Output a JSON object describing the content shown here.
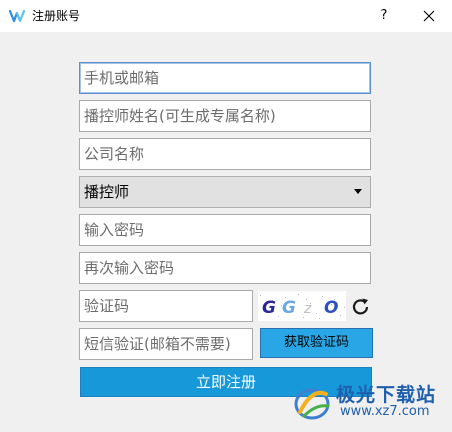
{
  "window": {
    "title": "注册账号",
    "help_label": "?",
    "app_icon": "app-logo-icon",
    "close_icon": "close-icon"
  },
  "form": {
    "phone_email_placeholder": "手机或邮箱",
    "streamer_name_placeholder": "播控师姓名(可生成专属名称)",
    "company_name_placeholder": "公司名称",
    "role_selected": "播控师",
    "password_placeholder": "输入密码",
    "password_confirm_placeholder": "再次输入密码",
    "captcha_placeholder": "验证码",
    "captcha_text": [
      "G",
      "G",
      "z",
      "O"
    ],
    "sms_code_placeholder": "短信验证(邮箱不需要)",
    "get_code_label": "获取验证码",
    "register_label": "立即注册"
  },
  "watermark": {
    "title": "极光下载站",
    "url": "www.xz7.com"
  },
  "colors": {
    "primary_button": "#1798d8",
    "sms_button": "#28a6e6",
    "focus_border": "#5a8fd0",
    "watermark": "#1f5fae"
  }
}
